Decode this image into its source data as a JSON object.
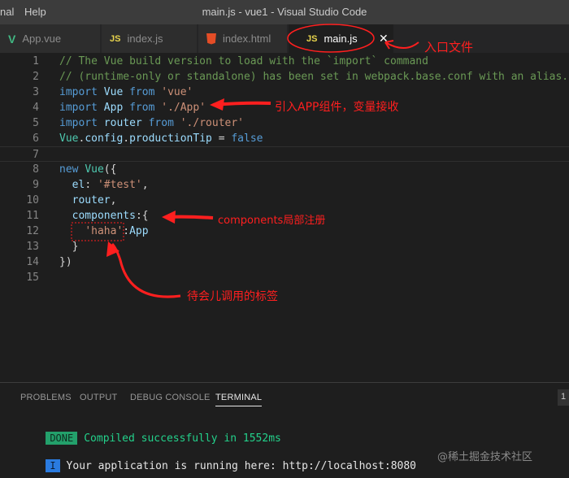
{
  "menu": {
    "item1": "nal",
    "item2": "Help"
  },
  "window_title": "main.js - vue1 - Visual Studio Code",
  "tabs": [
    {
      "label": "App.vue",
      "icon": "vue-icon"
    },
    {
      "label": "index.js",
      "icon": "js-icon",
      "icon_text": "JS"
    },
    {
      "label": "index.html",
      "icon": "html5-icon"
    },
    {
      "label": "main.js",
      "icon": "js-icon",
      "icon_text": "JS",
      "active": true
    }
  ],
  "code_lines": [
    {
      "n": "1",
      "parts": [
        [
          "cm",
          "// The Vue build version to load with the `import` command"
        ]
      ]
    },
    {
      "n": "2",
      "parts": [
        [
          "cm",
          "// (runtime-only or standalone) has been set in webpack.base.conf with an alias."
        ]
      ]
    },
    {
      "n": "3",
      "parts": [
        [
          "kw",
          "import "
        ],
        [
          "id",
          "Vue "
        ],
        [
          "kw",
          "from "
        ],
        [
          "st",
          "'vue'"
        ]
      ]
    },
    {
      "n": "4",
      "parts": [
        [
          "kw",
          "import "
        ],
        [
          "id",
          "App "
        ],
        [
          "kw",
          "from "
        ],
        [
          "st",
          "'./App'"
        ]
      ]
    },
    {
      "n": "5",
      "parts": [
        [
          "kw",
          "import "
        ],
        [
          "id",
          "router "
        ],
        [
          "kw",
          "from "
        ],
        [
          "st",
          "'./router'"
        ]
      ]
    },
    {
      "n": "6",
      "parts": [
        [
          "cls",
          "Vue"
        ],
        [
          "pl",
          "."
        ],
        [
          "id",
          "config"
        ],
        [
          "pl",
          "."
        ],
        [
          "id",
          "productionTip "
        ],
        [
          "pl",
          "= "
        ],
        [
          "kw",
          "false"
        ]
      ]
    },
    {
      "n": "7",
      "parts": []
    },
    {
      "n": "8",
      "parts": [
        [
          "kw",
          "new "
        ],
        [
          "cls",
          "Vue"
        ],
        [
          "pl",
          "({"
        ]
      ]
    },
    {
      "n": "9",
      "parts": [
        [
          "pl",
          "  "
        ],
        [
          "id",
          "el"
        ],
        [
          "pl",
          ": "
        ],
        [
          "st",
          "'#test'"
        ],
        [
          "pl",
          ","
        ]
      ]
    },
    {
      "n": "10",
      "parts": [
        [
          "pl",
          "  "
        ],
        [
          "id",
          "router"
        ],
        [
          "pl",
          ","
        ]
      ]
    },
    {
      "n": "11",
      "parts": [
        [
          "pl",
          "  "
        ],
        [
          "id",
          "components"
        ],
        [
          "pl",
          ":{"
        ]
      ]
    },
    {
      "n": "12",
      "parts": [
        [
          "pl",
          "    "
        ],
        [
          "st",
          "'haha'"
        ],
        [
          "pl",
          ":"
        ],
        [
          "id",
          "App"
        ]
      ]
    },
    {
      "n": "13",
      "parts": [
        [
          "pl",
          "  }"
        ]
      ]
    },
    {
      "n": "14",
      "parts": [
        [
          "pl",
          "})"
        ]
      ]
    },
    {
      "n": "15",
      "parts": []
    }
  ],
  "annotations": {
    "entry_file": "入口文件",
    "import_app": "引入APP组件，变量接收",
    "components_local": "components局部注册",
    "tag_to_call": "待会儿调用的标签"
  },
  "panel": {
    "tabs": [
      "PROBLEMS",
      "OUTPUT",
      "DEBUG CONSOLE",
      "TERMINAL"
    ],
    "active_tab": "TERMINAL",
    "counter": "1"
  },
  "terminal": {
    "done_badge": "DONE",
    "compiled": "Compiled successfully in 1552ms",
    "info_badge": "I",
    "running": "Your application is running here: http://localhost:8080"
  },
  "watermark": "@稀土掘金技术社区",
  "colors": {
    "editor_bg": "#1e1e1e",
    "comment": "#6a9955",
    "keyword": "#569cd6",
    "string": "#ce9178",
    "annotation_red": "#ff1f1f",
    "done_green": "#23a06b"
  }
}
